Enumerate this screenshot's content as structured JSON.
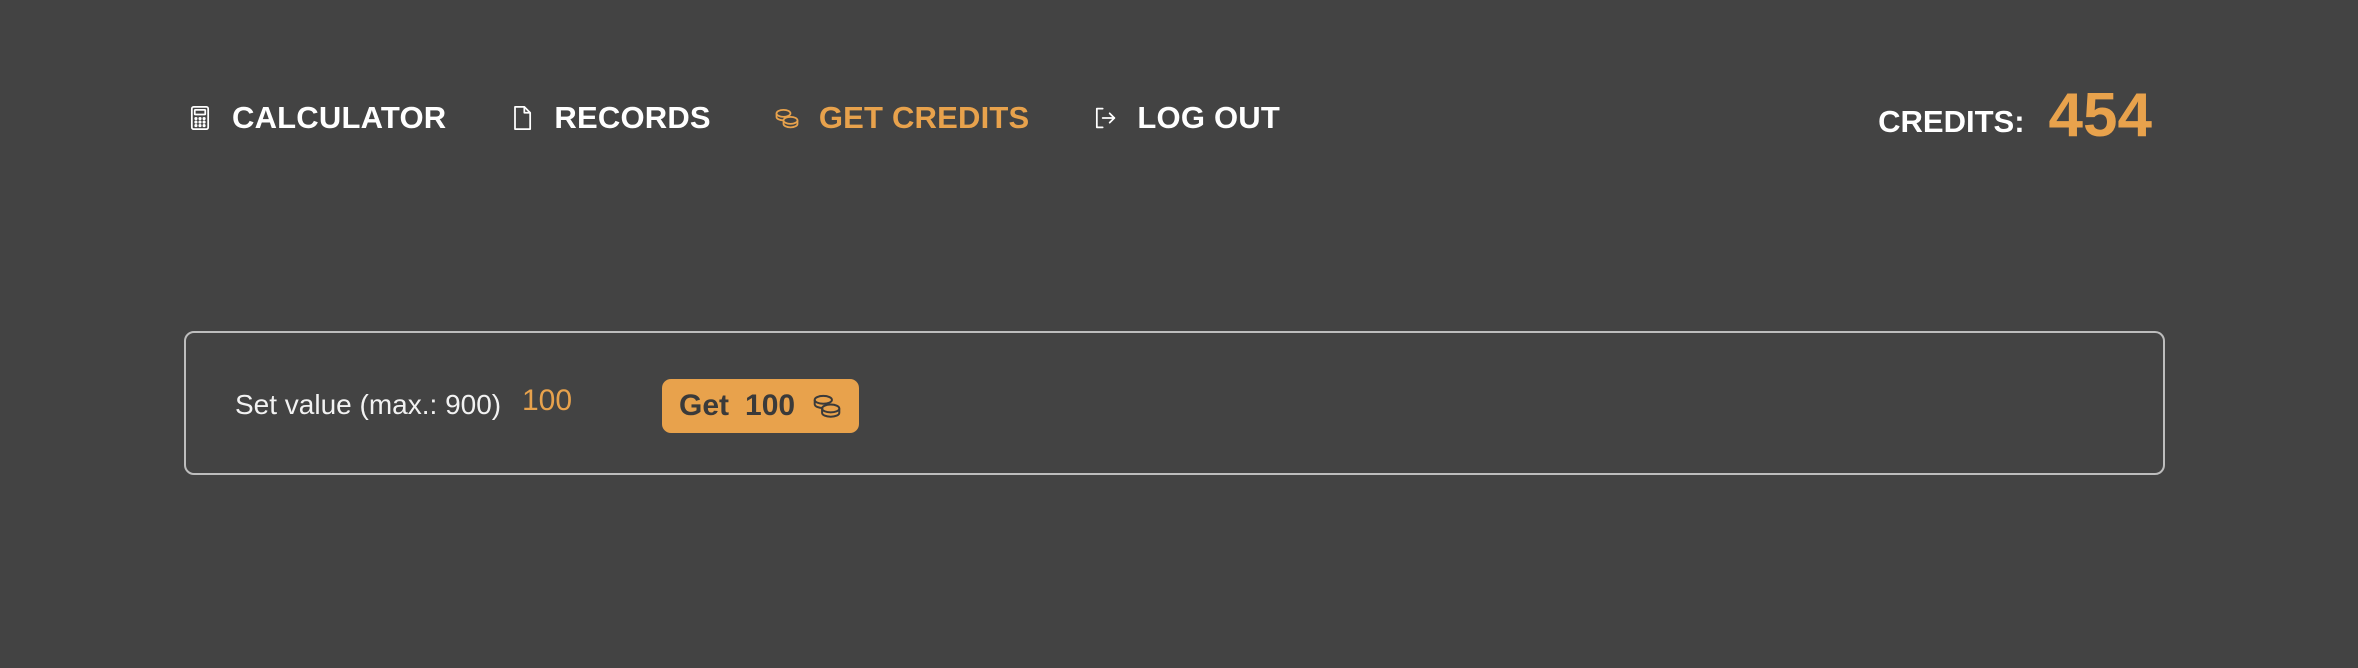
{
  "nav": {
    "items": [
      {
        "label": "CALCULATOR",
        "icon": "calculator-icon",
        "active": false
      },
      {
        "label": "RECORDS",
        "icon": "document-icon",
        "active": false
      },
      {
        "label": "GET CREDITS",
        "icon": "coins-icon",
        "active": true
      },
      {
        "label": "LOG OUT",
        "icon": "logout-icon",
        "active": false
      }
    ]
  },
  "credits": {
    "label": "CREDITS:",
    "value": "454"
  },
  "form": {
    "label": "Set value (max.: 900)",
    "input_value": "100",
    "button_prefix": "Get",
    "button_amount": "100",
    "button_icon": "coins-icon"
  },
  "colors": {
    "background": "#434343",
    "accent": "#e8a24c",
    "text": "#ffffff",
    "border": "#bdbdbd"
  }
}
